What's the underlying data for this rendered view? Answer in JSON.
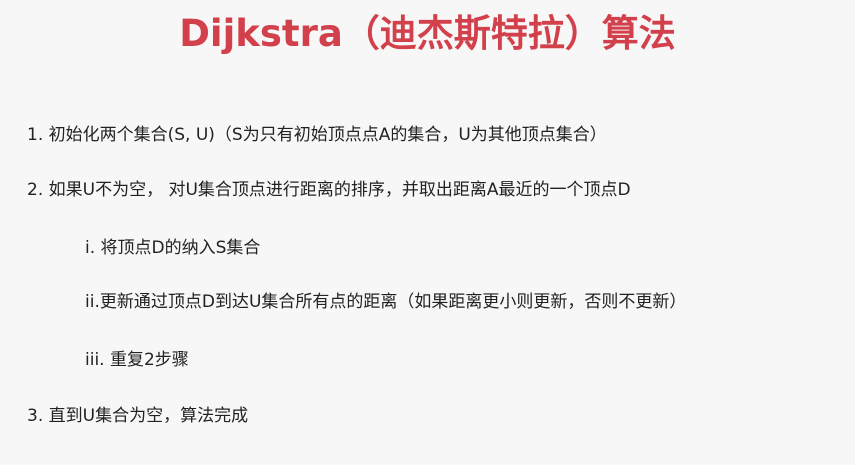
{
  "slide": {
    "title": "Dijkstra（迪杰斯特拉）算法",
    "title_color": "#d2404b",
    "text_color": "#222222",
    "background": "#f7f7f7",
    "steps": [
      "1. 初始化两个集合(S, U)（S为只有初始顶点点A的集合，U为其他顶点集合）",
      "2. 如果U不为空， 对U集合顶点进行距离的排序，并取出距离A最近的一个顶点D",
      "i. 将顶点D的纳入S集合",
      "ii.更新通过顶点D到达U集合所有点的距离（如果距离更小则更新，否则不更新）",
      "iii. 重复2步骤",
      "3. 直到U集合为空，算法完成"
    ]
  }
}
